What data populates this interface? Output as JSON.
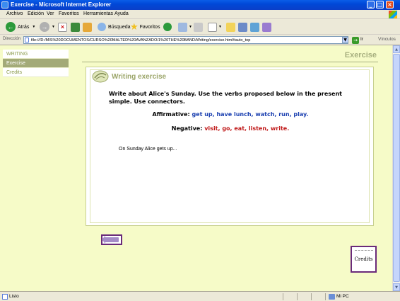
{
  "window": {
    "title": "Exercise - Microsoft Internet Explorer"
  },
  "menu": [
    "Archivo",
    "Edición",
    "Ver",
    "Favoritos",
    "Herramientas",
    "Ayuda"
  ],
  "toolbar": {
    "back_label": "Atrás",
    "search_label": "Búsqueda",
    "favorites_label": "Favoritos"
  },
  "address": {
    "label": "Dirección",
    "url": "file:///D:/MIS%20DOCUMENTOS/CURSO%20MALTED%20AVANZADO/1%20THE%20BAND/Writing/exercise.html#auto_top",
    "go_label": "Ir",
    "links_label": "Vínculos"
  },
  "sidebar": {
    "items": [
      {
        "label": "WRITING"
      },
      {
        "label": "Exercise"
      },
      {
        "label": "Credits"
      }
    ]
  },
  "page": {
    "heading": "Exercise",
    "exercise_title": "Writing exercise",
    "instructions": "Write about Alice's Sunday. Use the verbs proposed below in the present simple. Use connectors.",
    "affirmative_label": "Affirmative:",
    "affirmative_verbs": "get up, have lunch, watch, run, play.",
    "negative_label": "Negative:",
    "negative_verbs": "visit, go, eat, listen, write.",
    "answer_text": "On Sunday Alice gets up..."
  },
  "credits_button": {
    "label": "Credits"
  },
  "status": {
    "text": "Listo",
    "zone": "Mi PC"
  },
  "colors": {
    "page_bg": "#f6fbc8",
    "accent": "#a8b080",
    "affirmative": "#1a3fb0",
    "negative": "#c01818",
    "button_border": "#6a2a7a"
  }
}
